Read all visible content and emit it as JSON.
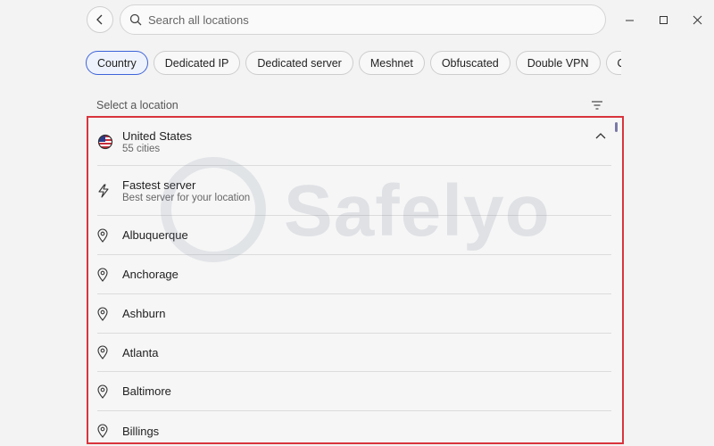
{
  "search": {
    "placeholder": "Search all locations"
  },
  "filters": [
    {
      "label": "Country",
      "active": true
    },
    {
      "label": "Dedicated IP"
    },
    {
      "label": "Dedicated server"
    },
    {
      "label": "Meshnet"
    },
    {
      "label": "Obfuscated"
    },
    {
      "label": "Double VPN"
    },
    {
      "label": "Onion O"
    }
  ],
  "section": {
    "label": "Select a location"
  },
  "country": {
    "name": "United States",
    "cities": "55 cities"
  },
  "fastest": {
    "title": "Fastest server",
    "subtitle": "Best server for your location"
  },
  "cities": [
    "Albuquerque",
    "Anchorage",
    "Ashburn",
    "Atlanta",
    "Baltimore",
    "Billings"
  ],
  "watermark": {
    "text": "Safelyo"
  },
  "colors": {
    "highlight": "#d9343c",
    "accent": "#3d63d9"
  }
}
